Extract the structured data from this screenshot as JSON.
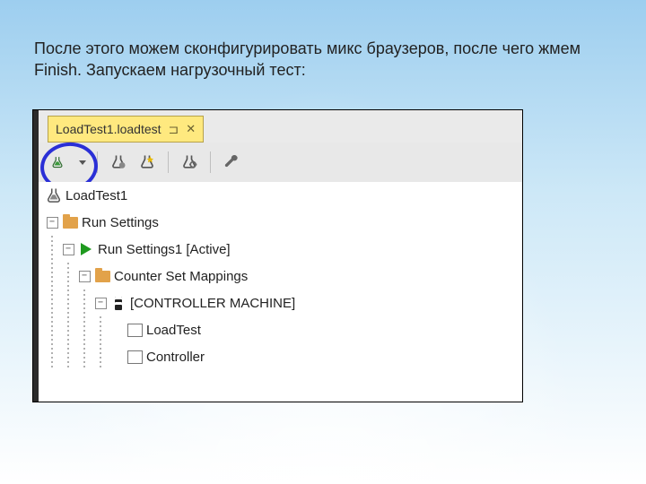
{
  "caption": "После этого можем сконфигурировать микс браузеров, после чего жмем Finish. Запускаем нагрузочный тест:",
  "tab": {
    "title": "LoadTest1.loadtest",
    "pin_glyph": "⊐",
    "close_glyph": "✕"
  },
  "toolbar": {
    "run": "run-loadtest",
    "dropdown": "run-dropdown",
    "manage": "manage-counters",
    "new": "new-loadtest",
    "settings": "test-settings",
    "wrench": "properties"
  },
  "tree": {
    "root": "LoadTest1",
    "run_settings": "Run Settings",
    "run_settings1": "Run Settings1 [Active]",
    "counter_mappings": "Counter Set Mappings",
    "controller": "[CONTROLLER MACHINE]",
    "items": [
      "LoadTest",
      "Controller"
    ]
  },
  "icons": {
    "flask_color": "#2e7d32",
    "gear_color": "#777777",
    "spark_color": "#e6b800"
  }
}
